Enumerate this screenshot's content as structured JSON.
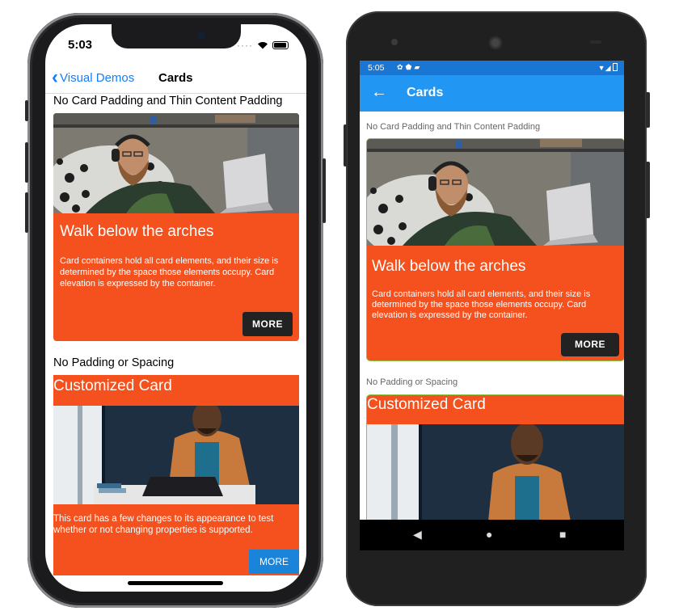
{
  "ios": {
    "status": {
      "time": "5:03",
      "icons": [
        "signal-dots-icon",
        "wifi-icon",
        "battery-icon"
      ]
    },
    "nav": {
      "back_label": "Visual Demos",
      "title": "Cards"
    },
    "sections": [
      {
        "heading": "No Card Padding and Thin Content Padding",
        "card": {
          "title": "Walk below the arches",
          "body": "Card containers hold all card elements, and their size is determined by the space those elements occupy. Card elevation is expressed by the container.",
          "button": "MORE"
        }
      },
      {
        "heading": "No Padding or Spacing",
        "card": {
          "title": "Customized Card",
          "body": "This card has a few changes to its appearance to test whether or not changing properties is supported.",
          "button": "MORE"
        }
      }
    ]
  },
  "android": {
    "status": {
      "time": "5:05",
      "left_icons": [
        "gear-icon",
        "shield-icon",
        "sd-card-icon"
      ],
      "right_icons": [
        "wifi-icon",
        "signal-icon",
        "battery-icon"
      ]
    },
    "toolbar": {
      "title": "Cards"
    },
    "sections": [
      {
        "heading": "No Card Padding and Thin Content Padding",
        "card": {
          "title": "Walk below the arches",
          "body": "Card containers hold all card elements, and their size is determined by the space those elements occupy. Card elevation is expressed by the container.",
          "button": "MORE"
        }
      },
      {
        "heading": "No Padding or Spacing",
        "card": {
          "title": "Customized Card"
        }
      }
    ],
    "nav": [
      "back-triangle-icon",
      "home-circle-icon",
      "recents-square-icon"
    ]
  },
  "colors": {
    "card_orange": "#f4511e",
    "ios_blue": "#147efb",
    "android_toolbar": "#2196f3",
    "android_status": "#1976d2",
    "card_border_green": "#8bc34a",
    "more_dark": "#222222",
    "more_blue": "#1a84db"
  }
}
